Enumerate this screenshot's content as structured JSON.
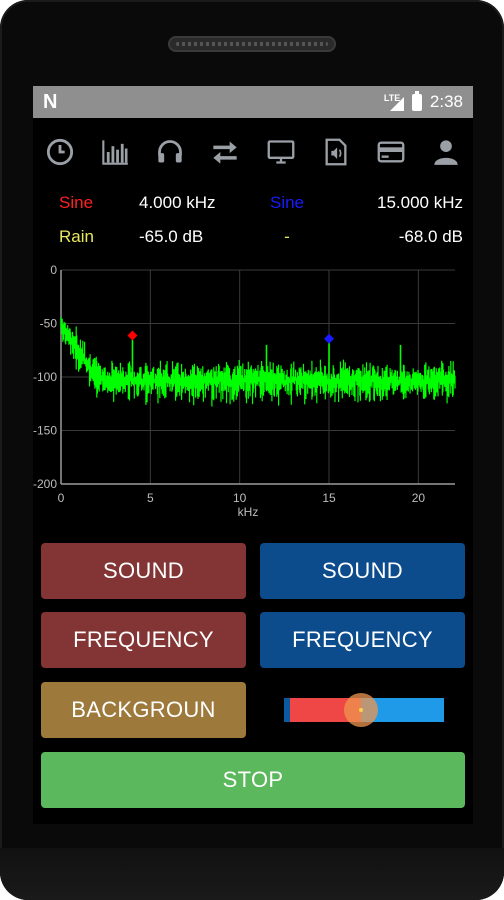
{
  "status_bar": {
    "notification": "N",
    "network": "LTE",
    "time": "2:38"
  },
  "toolbar": {
    "icons": [
      "clock-icon",
      "bar-chart-icon",
      "headphones-icon",
      "swap-arrows-icon",
      "monitor-icon",
      "audio-file-icon",
      "card-icon",
      "person-icon"
    ]
  },
  "channels": {
    "left": {
      "waveform": "Sine",
      "waveform_color": "#ff2020",
      "frequency": "4.000 kHz",
      "background": "Rain",
      "background_color": "#e8e860",
      "level": "-65.0 dB"
    },
    "right": {
      "waveform": "Sine",
      "waveform_color": "#1a1aff",
      "frequency": "15.000 kHz",
      "background": "-",
      "background_color": "#e8e860",
      "level": "-68.0 dB"
    }
  },
  "chart_data": {
    "type": "line",
    "title": "",
    "xlabel": "kHz",
    "ylabel": "",
    "xlim": [
      0,
      22.05
    ],
    "ylim": [
      -200,
      0
    ],
    "x_ticks": [
      "0",
      "5",
      "10",
      "15",
      "20"
    ],
    "y_ticks": [
      "0",
      "-50",
      "-100",
      "-150",
      "-200"
    ],
    "grid": true,
    "series_color": "#00ff00",
    "markers": [
      {
        "x": 4.0,
        "y": -65,
        "color": "#ff0000"
      },
      {
        "x": 15.0,
        "y": -68,
        "color": "#1a1aff"
      }
    ]
  },
  "buttons": {
    "left_sound": "SOUND",
    "right_sound": "SOUND",
    "left_frequency": "FREQUENCY",
    "right_frequency": "FREQUENCY",
    "background": "BACKGROUN",
    "stop": "STOP"
  },
  "balance_slider": {
    "value": 0.48
  },
  "colors": {
    "red_button": "#833535",
    "blue_button": "#0c4c8c",
    "gold_button": "#9d7a3c",
    "green_button": "#5cb85c"
  }
}
